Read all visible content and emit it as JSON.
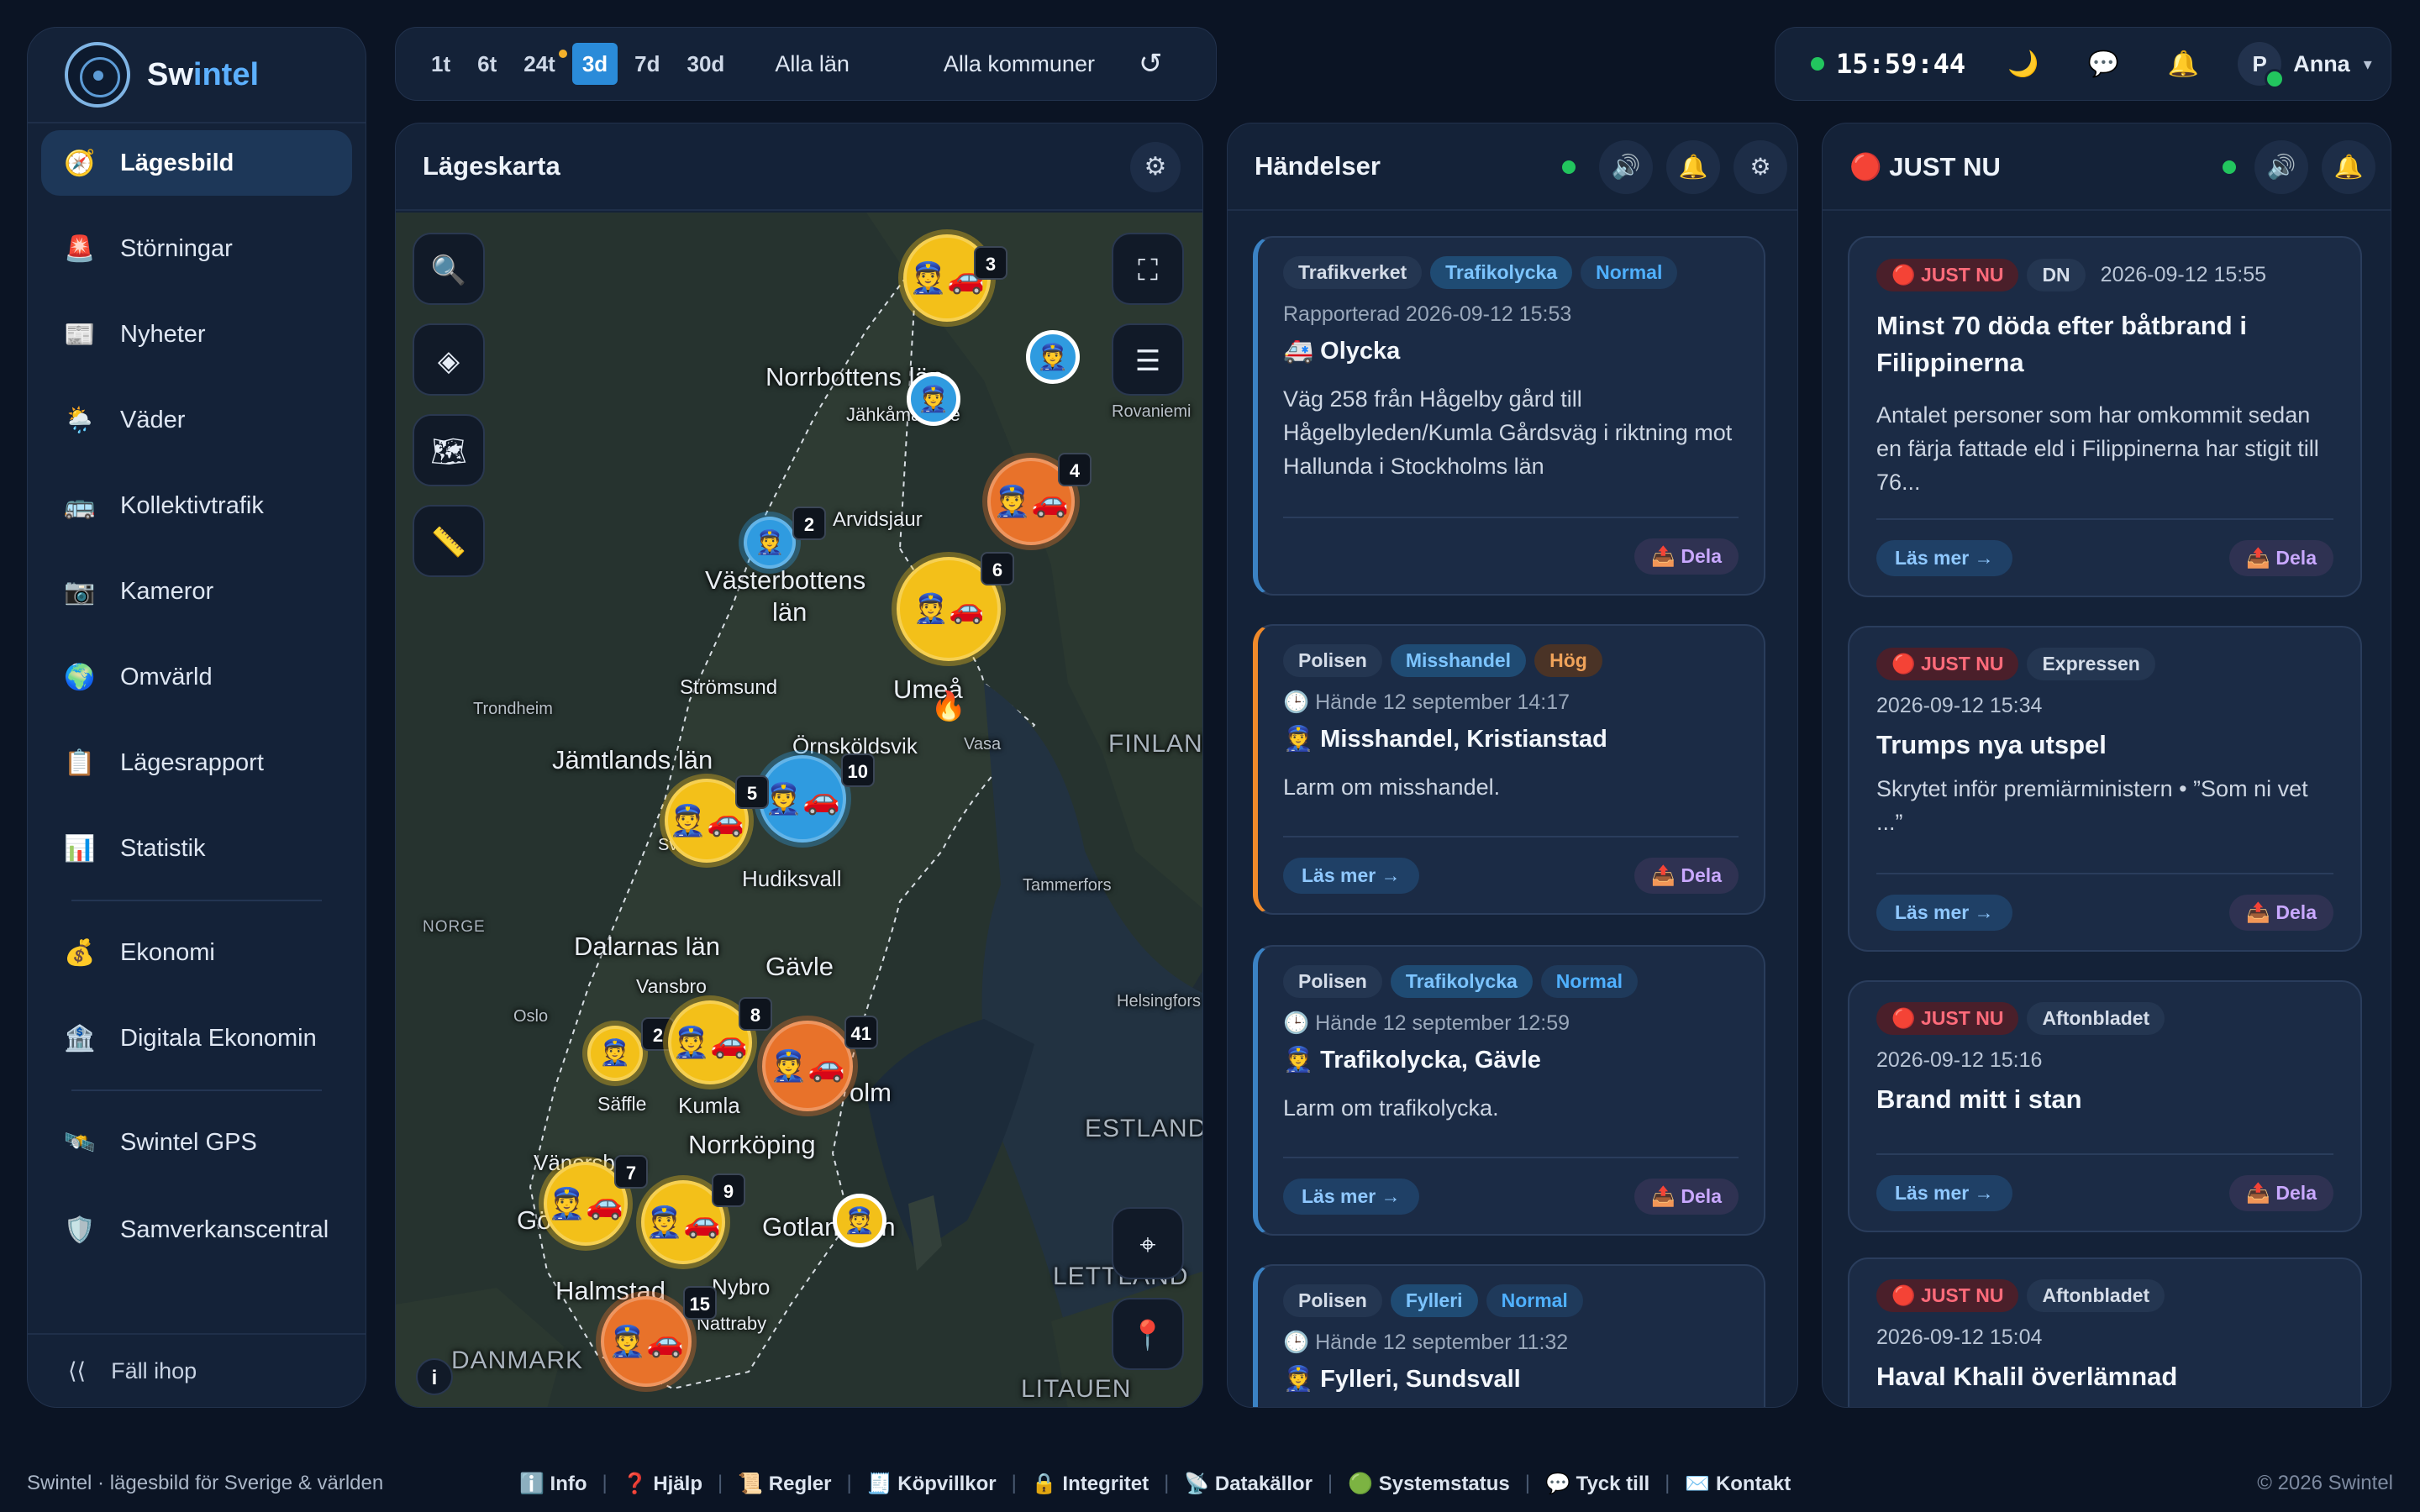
{
  "app": {
    "brand_prefix": "Sw",
    "brand_suffix": "intel"
  },
  "sidebar": {
    "items": [
      {
        "icon": "🧭",
        "label": "Lägesbild"
      },
      {
        "icon": "🚨",
        "label": "Störningar"
      },
      {
        "icon": "📰",
        "label": "Nyheter"
      },
      {
        "icon": "🌦️",
        "label": "Väder"
      },
      {
        "icon": "🚌",
        "label": "Kollektivtrafik"
      },
      {
        "icon": "📷",
        "label": "Kameror"
      },
      {
        "icon": "🌍",
        "label": "Omvärld"
      },
      {
        "icon": "📋",
        "label": "Lägesrapport"
      },
      {
        "icon": "📊",
        "label": "Statistik"
      },
      {
        "icon": "💰",
        "label": "Ekonomi"
      },
      {
        "icon": "🏦",
        "label": "Digitala Ekonomin"
      },
      {
        "icon": "🛰️",
        "label": "Swintel GPS"
      },
      {
        "icon": "🛡️",
        "label": "Samverkanscentral"
      }
    ],
    "collapse_icon": "⟨⟨",
    "collapse_label": "Fäll ihop"
  },
  "filters": {
    "time_ranges": [
      "1t",
      "6t",
      "24t",
      "3d",
      "7d",
      "30d"
    ],
    "active_range": "3d",
    "region": "Alla län",
    "municipality": "Alla kommuner",
    "refresh_icon": "↺"
  },
  "topbar": {
    "clock": "15:59:44",
    "theme_icon": "🌙",
    "chat_icon": "💬",
    "bell_icon": "🔔",
    "avatar_initial": "P",
    "user": "Anna",
    "caret": "▾"
  },
  "map_panel": {
    "title": "Lägeskarta",
    "gear_icon": "⚙",
    "labels": [
      {
        "text": "Norrbottens län"
      },
      {
        "text": "Jähkåmåhkke"
      },
      {
        "text": "Rovaniemi"
      },
      {
        "text": "Arvidsjaur"
      },
      {
        "text": "Västerbottens"
      },
      {
        "text": "län"
      },
      {
        "text": "Strömsund"
      },
      {
        "text": "Umeå"
      },
      {
        "text": "Trondheim"
      },
      {
        "text": "Örnsköldsvik"
      },
      {
        "text": "Vasa"
      },
      {
        "text": "FINLAND"
      },
      {
        "text": "Jämtlands län"
      },
      {
        "text": "Hudiksvall"
      },
      {
        "text": "Tammerfors"
      },
      {
        "text": "NORGE"
      },
      {
        "text": "Dalarnas län"
      },
      {
        "text": "Gävle"
      },
      {
        "text": "Vansbro"
      },
      {
        "text": "Oslo"
      },
      {
        "text": "Helsingfors"
      },
      {
        "text": "Säffle"
      },
      {
        "text": "Kumla"
      },
      {
        "text": "olm"
      },
      {
        "text": "ESTLAND"
      },
      {
        "text": "Norrköping"
      },
      {
        "text": "Vänersborg"
      },
      {
        "text": "Gotland län"
      },
      {
        "text": "Halmstad"
      },
      {
        "text": "Nybro"
      },
      {
        "text": "LETTLAND"
      },
      {
        "text": "Nattraby"
      },
      {
        "text": "DANMARK"
      },
      {
        "text": "LITAUEN"
      },
      {
        "text": "Sve"
      },
      {
        "text": "Gö"
      }
    ],
    "clusters": [
      {
        "count": "3",
        "icons": "👮🚗"
      },
      {
        "count": "",
        "icons": "👮"
      },
      {
        "count": "",
        "icons": "👮"
      },
      {
        "count": "4",
        "icons": "👮🚗"
      },
      {
        "count": "2",
        "icons": "👮"
      },
      {
        "count": "6",
        "icons": "👮🚗🔥"
      },
      {
        "count": "10",
        "icons": "👮🚗"
      },
      {
        "count": "5",
        "icons": "👮🚗"
      },
      {
        "count": "2",
        "icons": "👮"
      },
      {
        "count": "8",
        "icons": "👮🚗"
      },
      {
        "count": "41",
        "icons": "👮🚗"
      },
      {
        "count": "7",
        "icons": "👮🚗"
      },
      {
        "count": "9",
        "icons": "👮🚗"
      },
      {
        "count": "",
        "icons": "👮"
      },
      {
        "count": "15",
        "icons": "👮🚗"
      }
    ],
    "controls": {
      "search_icon": "🔍",
      "layers_icon": "◈",
      "map_icon": "🗺",
      "ruler_icon": "📏",
      "fullscreen_icon": "⛶",
      "filter_icon": "☰",
      "locate_icon": "⌖",
      "pin_icon": "📍",
      "info_icon": "i"
    }
  },
  "events_panel": {
    "title": "Händelser",
    "sound_icon": "🔊",
    "bell_icon": "🔔",
    "gear_icon": "⚙",
    "cards": [
      {
        "source": "Trafikverket",
        "type": "Trafikolycka",
        "severity": "Normal",
        "meta": "Rapporterad 2026-09-12 15:53",
        "title": "🚑 Olycka",
        "body": "Väg 258 från Hågelby gård till Hågelbyleden/Kumla Gårdsväg i riktning mot Hallunda i Stockholms län",
        "read_more": "",
        "share": "📤 Dela"
      },
      {
        "source": "Polisen",
        "type": "Misshandel",
        "severity": "Hög",
        "meta": "🕒 Hände 12 september 14:17",
        "title": "👮 Misshandel, Kristianstad",
        "body": "Larm om misshandel.",
        "read_more": "Läs mer →",
        "share": "📤 Dela"
      },
      {
        "source": "Polisen",
        "type": "Trafikolycka",
        "severity": "Normal",
        "meta": "🕒 Hände 12 september 12:59",
        "title": "👮 Trafikolycka, Gävle",
        "body": "Larm om trafikolycka.",
        "read_more": "Läs mer →",
        "share": "📤 Dela"
      },
      {
        "source": "Polisen",
        "type": "Fylleri",
        "severity": "Normal",
        "meta": "🕒 Hände 12 september 11:32",
        "title": "👮 Fylleri, Sundsvall",
        "body": "",
        "read_more": "",
        "share": ""
      }
    ]
  },
  "justnu_panel": {
    "title": "🔴 JUST NU",
    "sound_icon": "🔊",
    "bell_icon": "🔔",
    "cards": [
      {
        "tag": "🔴 JUST NU",
        "source": "DN",
        "date": "2026-09-12 15:55",
        "title": "Minst 70 döda efter båtbrand i Filippinerna",
        "body": "Antalet personer som har omkommit sedan en färja fattade eld i Filippinerna har stigit till 76...",
        "read_more": "Läs mer →",
        "share": "📤 Dela"
      },
      {
        "tag": "🔴 JUST NU",
        "source": "Expressen",
        "date": "2026-09-12 15:34",
        "title": "Trumps nya utspel",
        "body": "Skrytet inför premiärministern • ”Som ni vet ...”",
        "read_more": "Läs mer →",
        "share": "📤 Dela"
      },
      {
        "tag": "🔴 JUST NU",
        "source": "Aftonbladet",
        "date": "2026-09-12 15:16",
        "title": "Brand mitt i stan",
        "body": "",
        "read_more": "Läs mer →",
        "share": "📤 Dela"
      },
      {
        "tag": "🔴 JUST NU",
        "source": "Aftonbladet",
        "date": "2026-09-12 15:04",
        "title": "Haval Khalil överlämnad",
        "body": "",
        "read_more": "",
        "share": ""
      }
    ]
  },
  "footer": {
    "tagline": "Swintel · lägesbild för Sverige & världen",
    "links": [
      "ℹ️ Info",
      "❓ Hjälp",
      "📜 Regler",
      "🧾 Köpvillkor",
      "🔒 Integritet",
      "📡 Datakällor",
      "🟢 Systemstatus",
      "💬 Tyck till",
      "✉️ Kontakt"
    ],
    "copyright": "© 2026 Swintel"
  },
  "colors": {
    "accent": "#2a8bd9",
    "status_green": "#22c55e",
    "cluster_yellow": "#f3c019",
    "cluster_orange": "#e8722a",
    "cluster_blue": "#2f9be0"
  }
}
